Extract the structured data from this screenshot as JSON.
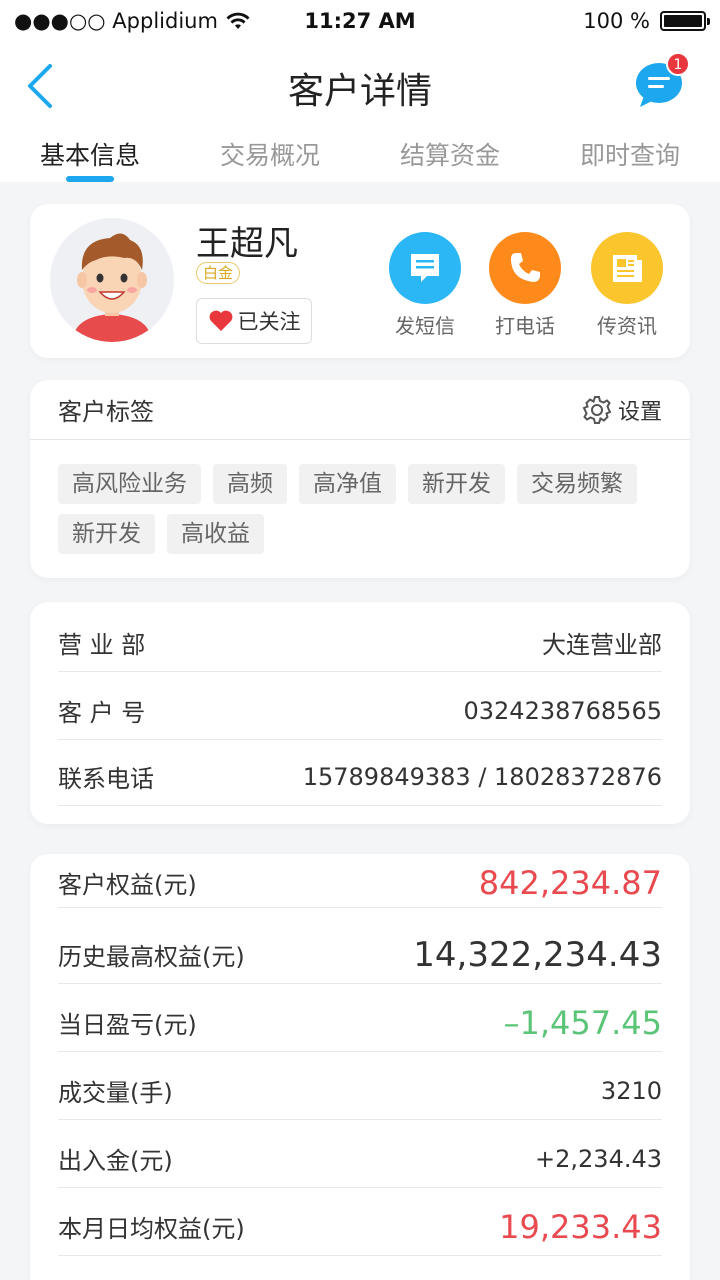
{
  "status_bar": {
    "carrier": "●●●○○ Applidium",
    "time": "11:27 AM",
    "battery": "100 %"
  },
  "nav": {
    "title": "客户详情",
    "message_badge": "1"
  },
  "tabs": [
    {
      "label": "基本信息",
      "active": true
    },
    {
      "label": "交易概况",
      "active": false
    },
    {
      "label": "结算资金",
      "active": false
    },
    {
      "label": "即时查询",
      "active": false
    }
  ],
  "profile": {
    "name": "王超凡",
    "level": "白金",
    "follow_label": "已关注",
    "actions": [
      {
        "label": "发短信",
        "icon": "message-icon",
        "color": "#2bb7f5"
      },
      {
        "label": "打电话",
        "icon": "phone-icon",
        "color": "#ff8a1c"
      },
      {
        "label": "传资讯",
        "icon": "news-icon",
        "color": "#fbc52d"
      }
    ]
  },
  "tags": {
    "title": "客户标签",
    "settings_label": "设置",
    "items": [
      "高风险业务",
      "高频",
      "高净值",
      "新开发",
      "交易频繁",
      "新开发",
      "高收益"
    ]
  },
  "info": {
    "rows": [
      {
        "label": "营 业 部",
        "value": "大连营业部"
      },
      {
        "label": "客 户 号",
        "value": "0324238768565"
      },
      {
        "label": "联系电话",
        "value": "15789849383 / 18028372876"
      }
    ]
  },
  "finance": {
    "rows": [
      {
        "label": "客户权益(元)",
        "value": "842,234.87",
        "color": "#e94a4f"
      },
      {
        "label": "历史最高权益(元)",
        "value": "14,322,234.43",
        "color": "#333333"
      },
      {
        "label": "当日盈亏(元)",
        "value": "–1,457.45",
        "color": "#5bc577"
      },
      {
        "label": "成交量(手)",
        "value": "3210",
        "color": "#333333"
      },
      {
        "label": "出入金(元)",
        "value": "+2,234.43",
        "color": "#333333"
      },
      {
        "label": "本月日均权益(元)",
        "value": "19,233.43",
        "color": "#e94a4f"
      }
    ]
  }
}
